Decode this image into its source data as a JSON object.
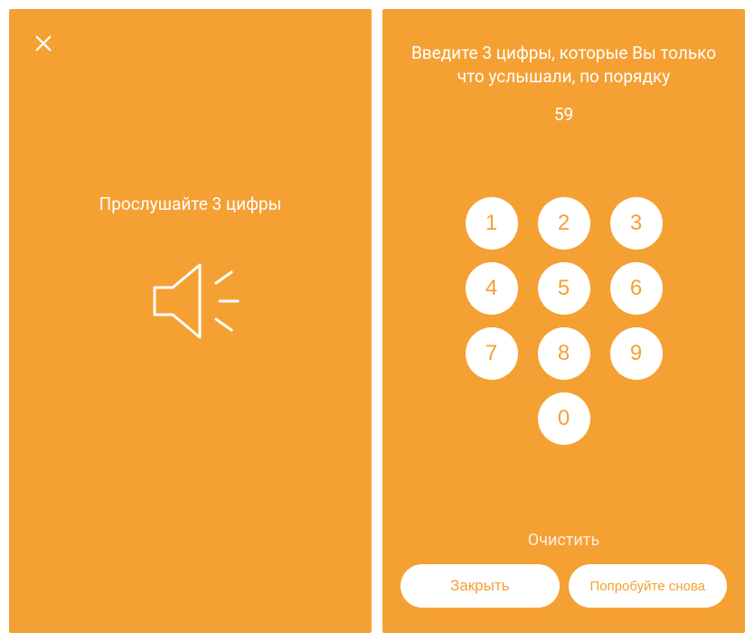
{
  "left": {
    "title": "Прослушайте 3 цифры"
  },
  "right": {
    "instruction": "Введите 3 цифры, которые Вы только что услышали, по порядку",
    "timer": "59",
    "keys": {
      "k1": "1",
      "k2": "2",
      "k3": "3",
      "k4": "4",
      "k5": "5",
      "k6": "6",
      "k7": "7",
      "k8": "8",
      "k9": "9",
      "k0": "0"
    },
    "clear": "Очистить",
    "close_btn": "Закрыть",
    "retry_btn": "Попробуйте снова"
  }
}
